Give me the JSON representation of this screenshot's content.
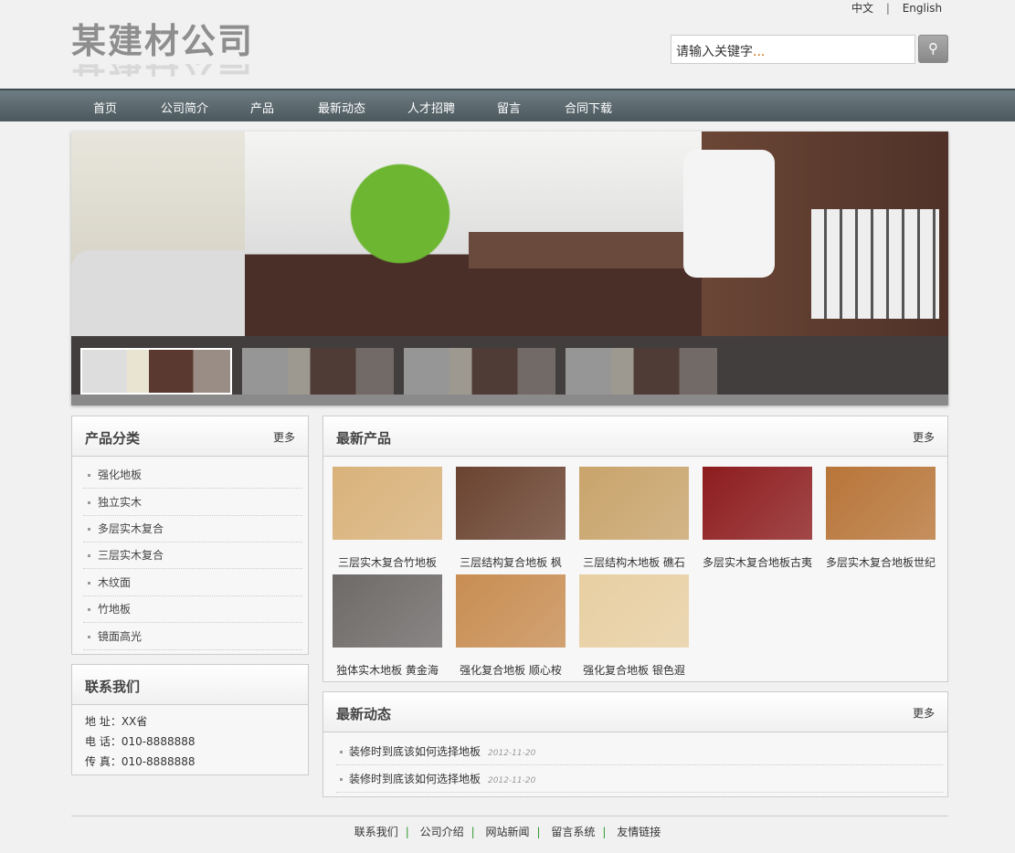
{
  "header": {
    "logo": "某建材公司",
    "lang": [
      "中文",
      "English"
    ],
    "lang_sep": "|",
    "search_placeholder": "请输入关键字",
    "search_dots": "...",
    "search_icon": "magnifier-icon"
  },
  "nav": [
    "首页",
    "公司简介",
    "产品",
    "最新动态",
    "人才招聘",
    "留言",
    "合同下载"
  ],
  "categories": {
    "title": "产品分类",
    "more": "更多",
    "items": [
      "强化地板",
      "独立实木",
      "多层实木复合",
      "三层实木复合",
      "木纹面",
      "竹地板",
      "镜面高光"
    ]
  },
  "contact": {
    "title": "联系我们",
    "lines": [
      "地 址：XX省",
      "电 话：010-8888888",
      "传 真：010-8888888"
    ]
  },
  "products": {
    "title": "最新产品",
    "more": "更多",
    "items": [
      {
        "name": "三层实木复合竹地板",
        "color": "#d9b27a"
      },
      {
        "name": "三层结构复合地板 枫",
        "color": "#6b4330"
      },
      {
        "name": "三层结构木地板 礁石",
        "color": "#c9a46b"
      },
      {
        "name": "多层实木复合地板古夷",
        "color": "#8d1c1e"
      },
      {
        "name": "多层实木复合地板世纪",
        "color": "#b87538"
      },
      {
        "name": "独体实木地板 黄金海",
        "color": "#6d6a68"
      },
      {
        "name": "强化复合地板 顺心桉",
        "color": "#c88d52"
      },
      {
        "name": "强化复合地板 银色遐",
        "color": "#e8cfa2"
      }
    ]
  },
  "news": {
    "title": "最新动态",
    "more": "更多",
    "items": [
      {
        "title": "装修时到底该如何选择地板",
        "date": "2012-11-20"
      },
      {
        "title": "装修时到底该如何选择地板",
        "date": "2012-11-20"
      }
    ]
  },
  "footer": {
    "links": [
      "联系我们",
      "公司介绍",
      "网站新闻",
      "留言系统",
      "友情链接"
    ],
    "sep": "|"
  }
}
